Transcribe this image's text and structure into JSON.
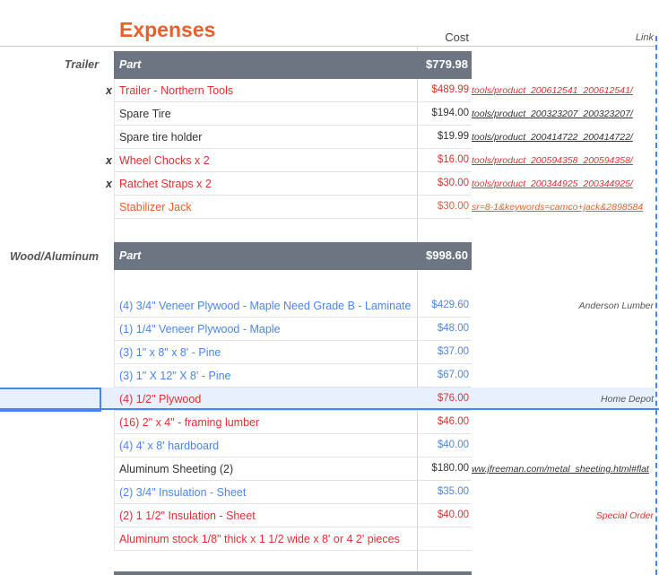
{
  "header": {
    "title": "Expenses",
    "cost_header": "Cost",
    "link_header": "Link"
  },
  "sections": [
    {
      "label": "Trailer",
      "part_label": "Part",
      "total": "$779.98",
      "rows": [
        {
          "mark": "x",
          "name": "Trailer - Northern Tools",
          "cost": "$489.99",
          "link": "/tools/product_200612541_200612541",
          "color": "red",
          "is_url": true
        },
        {
          "mark": "",
          "name": "Spare Tire",
          "cost": "$194.00",
          "link": "/tools/product_200323207_200323207",
          "color": "dark",
          "is_url": true
        },
        {
          "mark": "",
          "name": "Spare tire holder",
          "cost": "$19.99",
          "link": "/tools/product_200414722_200414722",
          "color": "dark",
          "is_url": true
        },
        {
          "mark": "x",
          "name": "Wheel Chocks x 2",
          "cost": "$16.00",
          "link": "/tools/product_200594358_200594358",
          "color": "red",
          "is_url": true
        },
        {
          "mark": "x",
          "name": "Ratchet Straps x 2",
          "cost": "$30.00",
          "link": "/tools/product_200344925_200344925",
          "color": "red",
          "is_url": true
        },
        {
          "mark": "",
          "name": "Stabilizer Jack",
          "cost": "$30.00",
          "link": "2898584&sr=8-1&keywords=camco+jack",
          "color": "orange",
          "is_url": true
        }
      ]
    },
    {
      "label": "Wood/Aluminum",
      "part_label": "Part",
      "total": "$998.60",
      "rows": [
        {
          "mark": "",
          "name": "(4) 3/4\" Veneer Plywood - Maple Need Grade B - Laminate",
          "cost": "$429.60",
          "link": "Anderson Lumber",
          "color": "blue",
          "link_color": "gray",
          "is_url": false
        },
        {
          "mark": "",
          "name": "(1) 1/4\" Veneer Plywood - Maple",
          "cost": "$48.00",
          "link": "",
          "color": "blue",
          "is_url": false
        },
        {
          "mark": "",
          "name": "(3) 1\" x 8\" x 8' - Pine",
          "cost": "$37.00",
          "link": "",
          "color": "blue",
          "is_url": false
        },
        {
          "mark": "",
          "name": "(3) 1\" X 12\" X 8' - Pine",
          "cost": "$67.00",
          "link": "",
          "color": "blue",
          "is_url": false
        },
        {
          "mark": "",
          "name": "(4) 1/2\" Plywood",
          "cost": "$76.00",
          "link": "Home Depot",
          "color": "red",
          "link_color": "gray",
          "is_url": false
        },
        {
          "mark": "",
          "name": "(16) 2\" x 4\" - framing lumber",
          "cost": "$46.00",
          "link": "",
          "color": "red",
          "is_url": false
        },
        {
          "mark": "",
          "name": "(4) 4' x 8' hardboard",
          "cost": "$40.00",
          "link": "",
          "color": "blue",
          "is_url": false
        },
        {
          "mark": "",
          "name": "Aluminum Sheeting (2)",
          "cost": "$180.00",
          "link": "ww.jfreeman.com/metal_sheeting.html#flat",
          "color": "dark",
          "is_url": true
        },
        {
          "mark": "",
          "name": "(2) 3/4\" Insulation - Sheet",
          "cost": "$35.00",
          "link": "",
          "color": "blue",
          "is_url": false
        },
        {
          "mark": "",
          "name": "(2) 1 1/2\" Insulation - Sheet",
          "cost": "$40.00",
          "link": "Special Order",
          "color": "red",
          "link_color": "red",
          "is_url": false
        },
        {
          "mark": "",
          "name": "Aluminum stock 1/8\" thick x 1 1/2 wide  x 8' or 4 2' pieces",
          "cost": "",
          "link": "",
          "color": "red",
          "is_url": false
        }
      ]
    }
  ],
  "colors": {
    "accent": "#e8602c",
    "band": "#6d7482",
    "selection": "#4a86e8"
  }
}
